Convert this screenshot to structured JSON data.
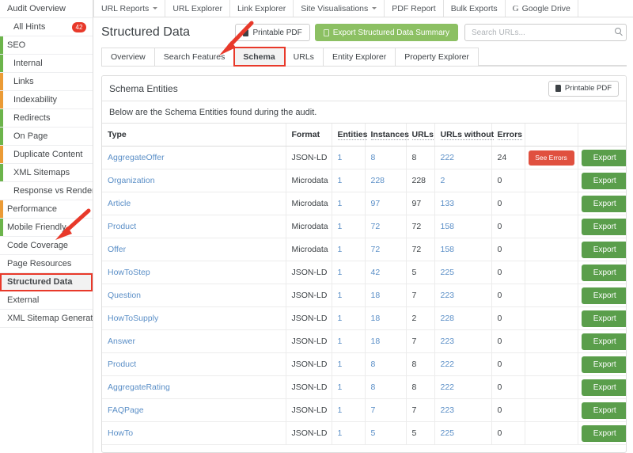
{
  "sidebar": {
    "items": [
      {
        "label": "Audit Overview",
        "level": 0,
        "bar": null,
        "badge": null,
        "selected": false
      },
      {
        "label": "All Hints",
        "level": 1,
        "bar": null,
        "badge": "42",
        "selected": false
      },
      {
        "label": "SEO",
        "level": 0,
        "bar": "#6cb44b",
        "badge": null,
        "selected": false
      },
      {
        "label": "Internal",
        "level": 1,
        "bar": "#6cb44b",
        "badge": null,
        "selected": false
      },
      {
        "label": "Links",
        "level": 1,
        "bar": "#eb9b36",
        "badge": null,
        "selected": false
      },
      {
        "label": "Indexability",
        "level": 1,
        "bar": "#eb9b36",
        "badge": null,
        "selected": false
      },
      {
        "label": "Redirects",
        "level": 1,
        "bar": "#6cb44b",
        "badge": null,
        "selected": false
      },
      {
        "label": "On Page",
        "level": 1,
        "bar": "#6cb44b",
        "badge": null,
        "selected": false
      },
      {
        "label": "Duplicate Content",
        "level": 1,
        "bar": "#eb9b36",
        "badge": null,
        "selected": false
      },
      {
        "label": "XML Sitemaps",
        "level": 1,
        "bar": "#6cb44b",
        "badge": null,
        "selected": false
      },
      {
        "label": "Response vs Render",
        "level": 1,
        "bar": null,
        "badge": null,
        "selected": false
      },
      {
        "label": "Performance",
        "level": 0,
        "bar": "#eb9b36",
        "badge": null,
        "selected": false
      },
      {
        "label": "Mobile Friendly",
        "level": 0,
        "bar": "#6cb44b",
        "badge": null,
        "selected": false
      },
      {
        "label": "Code Coverage",
        "level": 0,
        "bar": null,
        "badge": null,
        "selected": false
      },
      {
        "label": "Page Resources",
        "level": 0,
        "bar": null,
        "badge": null,
        "selected": false
      },
      {
        "label": "Structured Data",
        "level": 0,
        "bar": null,
        "badge": null,
        "selected": true
      },
      {
        "label": "External",
        "level": 0,
        "bar": null,
        "badge": null,
        "selected": false
      },
      {
        "label": "XML Sitemap Generator",
        "level": 0,
        "bar": null,
        "badge": null,
        "selected": false
      }
    ]
  },
  "topnav": {
    "items": [
      {
        "label": "URL Reports",
        "caret": true,
        "icon": null
      },
      {
        "label": "URL Explorer",
        "caret": false,
        "icon": null
      },
      {
        "label": "Link Explorer",
        "caret": false,
        "icon": null
      },
      {
        "label": "Site Visualisations",
        "caret": true,
        "icon": null
      },
      {
        "label": "PDF Report",
        "caret": false,
        "icon": null
      },
      {
        "label": "Bulk Exports",
        "caret": false,
        "icon": null
      },
      {
        "label": "Google Drive",
        "caret": false,
        "icon": "google-drive-icon"
      }
    ]
  },
  "header": {
    "title": "Structured Data",
    "printable_pdf_label": "Printable PDF",
    "export_summary_label": "Export Structured Data Summary",
    "search_placeholder": "Search URLs...",
    "search_value": ""
  },
  "subtabs": {
    "items": [
      {
        "label": "Overview",
        "active": false
      },
      {
        "label": "Search Features",
        "active": false
      },
      {
        "label": "Schema",
        "active": true
      },
      {
        "label": "URLs",
        "active": false
      },
      {
        "label": "Entity Explorer",
        "active": false
      },
      {
        "label": "Property Explorer",
        "active": false
      }
    ]
  },
  "panel": {
    "title": "Schema Entities",
    "printable_pdf_label": "Printable PDF",
    "description": "Below are the Schema Entities found during the audit.",
    "columns": [
      "Type",
      "Format",
      "Entities",
      "Instances",
      "URLs",
      "URLs without",
      "Errors",
      "",
      ""
    ],
    "see_errors_label": "See Errors",
    "export_label": "Export",
    "rows": [
      {
        "type": "AggregateOffer",
        "format": "JSON-LD",
        "entities": "1",
        "instances": "8",
        "urls": "8",
        "urls_without": "222",
        "errors": "24",
        "has_errors_button": true
      },
      {
        "type": "Organization",
        "format": "Microdata",
        "entities": "1",
        "instances": "228",
        "urls": "228",
        "urls_without": "2",
        "errors": "0",
        "has_errors_button": false
      },
      {
        "type": "Article",
        "format": "Microdata",
        "entities": "1",
        "instances": "97",
        "urls": "97",
        "urls_without": "133",
        "errors": "0",
        "has_errors_button": false
      },
      {
        "type": "Product",
        "format": "Microdata",
        "entities": "1",
        "instances": "72",
        "urls": "72",
        "urls_without": "158",
        "errors": "0",
        "has_errors_button": false
      },
      {
        "type": "Offer",
        "format": "Microdata",
        "entities": "1",
        "instances": "72",
        "urls": "72",
        "urls_without": "158",
        "errors": "0",
        "has_errors_button": false
      },
      {
        "type": "HowToStep",
        "format": "JSON-LD",
        "entities": "1",
        "instances": "42",
        "urls": "5",
        "urls_without": "225",
        "errors": "0",
        "has_errors_button": false
      },
      {
        "type": "Question",
        "format": "JSON-LD",
        "entities": "1",
        "instances": "18",
        "urls": "7",
        "urls_without": "223",
        "errors": "0",
        "has_errors_button": false
      },
      {
        "type": "HowToSupply",
        "format": "JSON-LD",
        "entities": "1",
        "instances": "18",
        "urls": "2",
        "urls_without": "228",
        "errors": "0",
        "has_errors_button": false
      },
      {
        "type": "Answer",
        "format": "JSON-LD",
        "entities": "1",
        "instances": "18",
        "urls": "7",
        "urls_without": "223",
        "errors": "0",
        "has_errors_button": false
      },
      {
        "type": "Product",
        "format": "JSON-LD",
        "entities": "1",
        "instances": "8",
        "urls": "8",
        "urls_without": "222",
        "errors": "0",
        "has_errors_button": false
      },
      {
        "type": "AggregateRating",
        "format": "JSON-LD",
        "entities": "1",
        "instances": "8",
        "urls": "8",
        "urls_without": "222",
        "errors": "0",
        "has_errors_button": false
      },
      {
        "type": "FAQPage",
        "format": "JSON-LD",
        "entities": "1",
        "instances": "7",
        "urls": "7",
        "urls_without": "223",
        "errors": "0",
        "has_errors_button": false
      },
      {
        "type": "HowTo",
        "format": "JSON-LD",
        "entities": "1",
        "instances": "5",
        "urls": "5",
        "urls_without": "225",
        "errors": "0",
        "has_errors_button": false
      }
    ]
  },
  "annotations": {
    "highlight_color": "#e8392a",
    "arrows": [
      {
        "name": "arrow-to-schema-tab"
      },
      {
        "name": "arrow-to-structured-data-sidebar"
      }
    ]
  }
}
